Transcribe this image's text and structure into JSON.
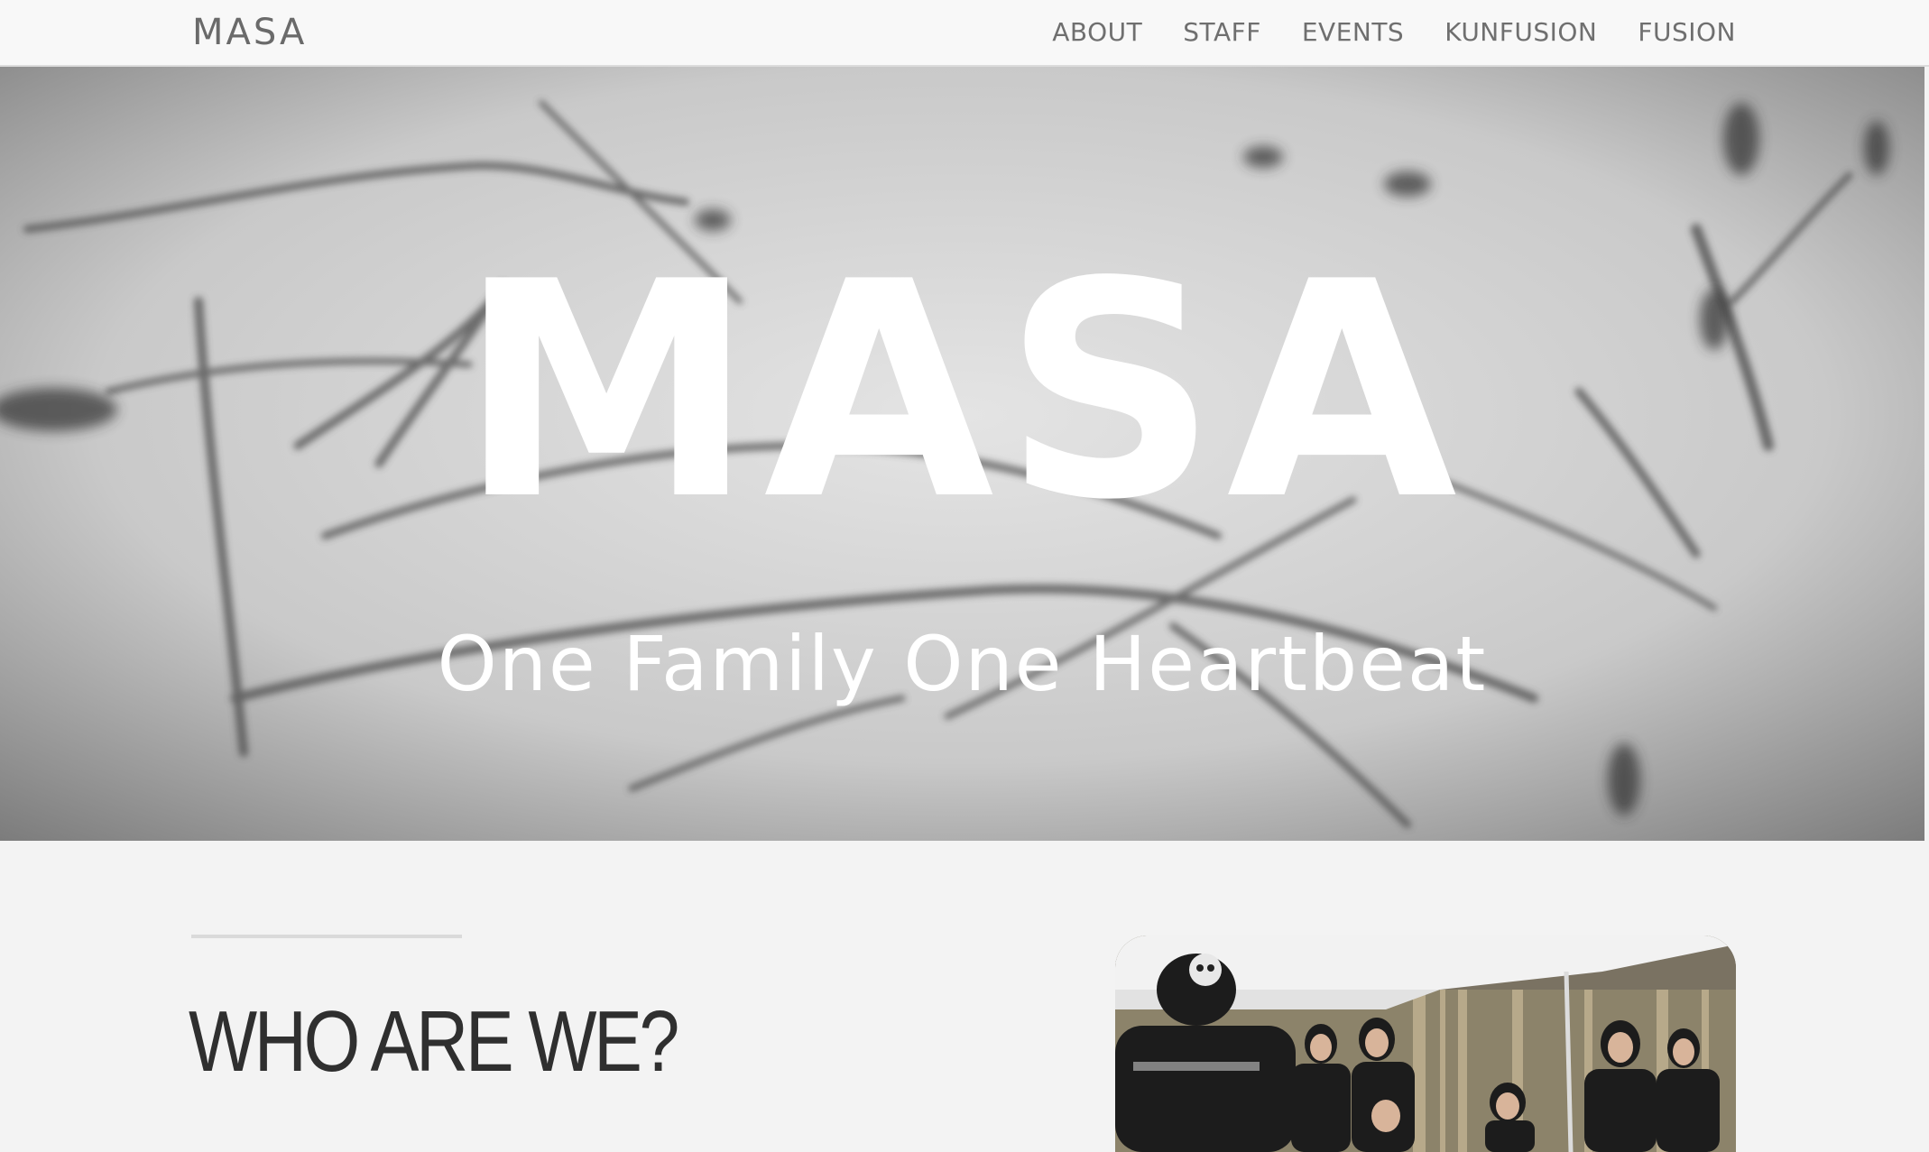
{
  "navbar": {
    "brand": "MASA",
    "links": [
      {
        "label": "ABOUT"
      },
      {
        "label": "STAFF"
      },
      {
        "label": "EVENTS"
      },
      {
        "label": "KUNFUSION"
      },
      {
        "label": "FUSION"
      }
    ]
  },
  "hero": {
    "title": "MASA",
    "subtitle": "One Family One Heartbeat"
  },
  "about": {
    "heading": "WHO ARE WE?"
  },
  "colors": {
    "page_background": "#f3f3f3",
    "navbar_background": "#f8f8f8",
    "nav_text": "#6f6f6f",
    "hero_text": "#ffffff",
    "heading_text": "#2f2f2f"
  }
}
